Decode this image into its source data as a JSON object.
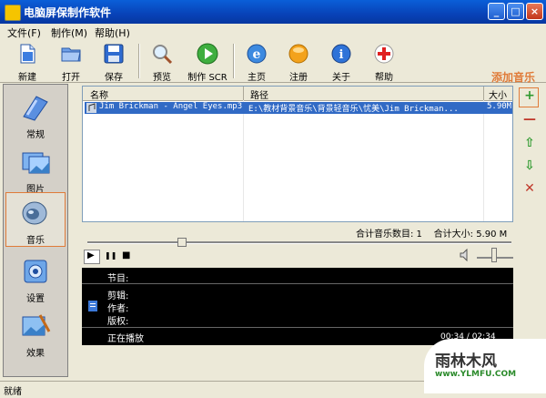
{
  "window": {
    "title": "电脑屏保制作软件",
    "buttons": {
      "minimize": "_",
      "maximize": "□",
      "close": "×"
    }
  },
  "menu": [
    "文件(F)",
    "制作(M)",
    "帮助(H)"
  ],
  "toolbar": [
    {
      "label": "新建",
      "icon": "new-file-icon"
    },
    {
      "label": "打开",
      "icon": "open-folder-icon"
    },
    {
      "label": "保存",
      "icon": "save-disk-icon"
    },
    {
      "label": "预览",
      "icon": "magnifier-icon"
    },
    {
      "label": "制作 SCR",
      "icon": "play-green-icon"
    },
    {
      "label": "主页",
      "icon": "ie-globe-icon"
    },
    {
      "label": "注册",
      "icon": "orange-orb-icon"
    },
    {
      "label": "关于",
      "icon": "info-icon"
    },
    {
      "label": "帮助",
      "icon": "help-cross-icon"
    }
  ],
  "sidebar": [
    {
      "label": "常规",
      "icon": "general-icon"
    },
    {
      "label": "图片",
      "icon": "picture-icon"
    },
    {
      "label": "音乐",
      "icon": "speaker-icon"
    },
    {
      "label": "设置",
      "icon": "settings-icon"
    },
    {
      "label": "效果",
      "icon": "effect-icon"
    }
  ],
  "list": {
    "columns": [
      "名称",
      "路径",
      "大小"
    ],
    "rows": [
      {
        "name": "Jim Brickman - Angel Eyes.mp3",
        "path": "E:\\教材背景音乐\\背景轻音乐\\忧美\\Jim Brickman...",
        "size": "5.90M"
      }
    ]
  },
  "annotation": "添加音乐",
  "right_buttons": [
    {
      "symbol": "+",
      "color": "#2f9a2f"
    },
    {
      "symbol": "—",
      "color": "#c0392b"
    },
    {
      "symbol": "⇧",
      "color": "#2f9a2f"
    },
    {
      "symbol": "⇩",
      "color": "#2f9a2f"
    },
    {
      "symbol": "✕",
      "color": "#c0392b"
    }
  ],
  "summary": {
    "count_label": "合计音乐数目: 1",
    "size_label": "合计大小: 5.90 M"
  },
  "player": {
    "play": "▶",
    "pause": "❚❚",
    "stop": "■",
    "volume_icon": "speaker-volume-icon"
  },
  "info": {
    "program_label": "节目:",
    "album_label": "剪辑:",
    "author_label": "作者:",
    "copyright_label": "版权:",
    "playing_label": "正在播放",
    "time": "00:34 / 02:34"
  },
  "status": "就绪",
  "watermark": {
    "text": "雨林木风",
    "url": "www.YLMFU.COM"
  }
}
